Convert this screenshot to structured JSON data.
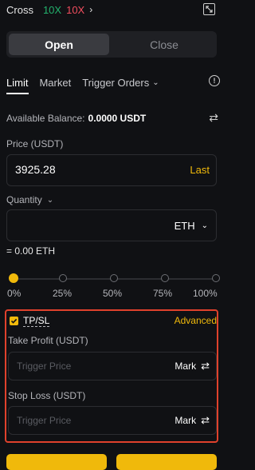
{
  "header": {
    "margin_mode": "Cross",
    "leverage_long": "10X",
    "leverage_short": "10X",
    "chevron": "›",
    "expand_icon": "expand-icon",
    "colors": {
      "long": "#23b26d",
      "short": "#f04d5e"
    }
  },
  "toggle": {
    "open_label": "Open",
    "close_label": "Close",
    "selected": "Open"
  },
  "tabs": {
    "items": [
      "Limit",
      "Market",
      "Trigger Orders"
    ],
    "selected": "Limit",
    "info_icon": "info-icon"
  },
  "balance": {
    "label": "Available Balance:",
    "value": "0.0000 USDT",
    "swap_icon": "transfer-icon"
  },
  "price": {
    "label": "Price (USDT)",
    "value": "3925.28",
    "last_label": "Last"
  },
  "quantity": {
    "label": "Quantity",
    "unit": "ETH",
    "equiv": "= 0.00 ETH"
  },
  "slider": {
    "stops": [
      "0%",
      "25%",
      "50%",
      "75%",
      "100%"
    ],
    "value_percent": 0
  },
  "tpsl": {
    "checked": true,
    "label": "TP/SL",
    "advanced_label": "Advanced",
    "take_profit": {
      "label": "Take Profit (USDT)",
      "placeholder": "Trigger Price",
      "mode": "Mark"
    },
    "stop_loss": {
      "label": "Stop Loss (USDT)",
      "placeholder": "Trigger Price",
      "mode": "Mark"
    }
  },
  "theme": {
    "accent": "#f0b90b",
    "highlight_border": "#e0412c",
    "background": "#101114"
  }
}
